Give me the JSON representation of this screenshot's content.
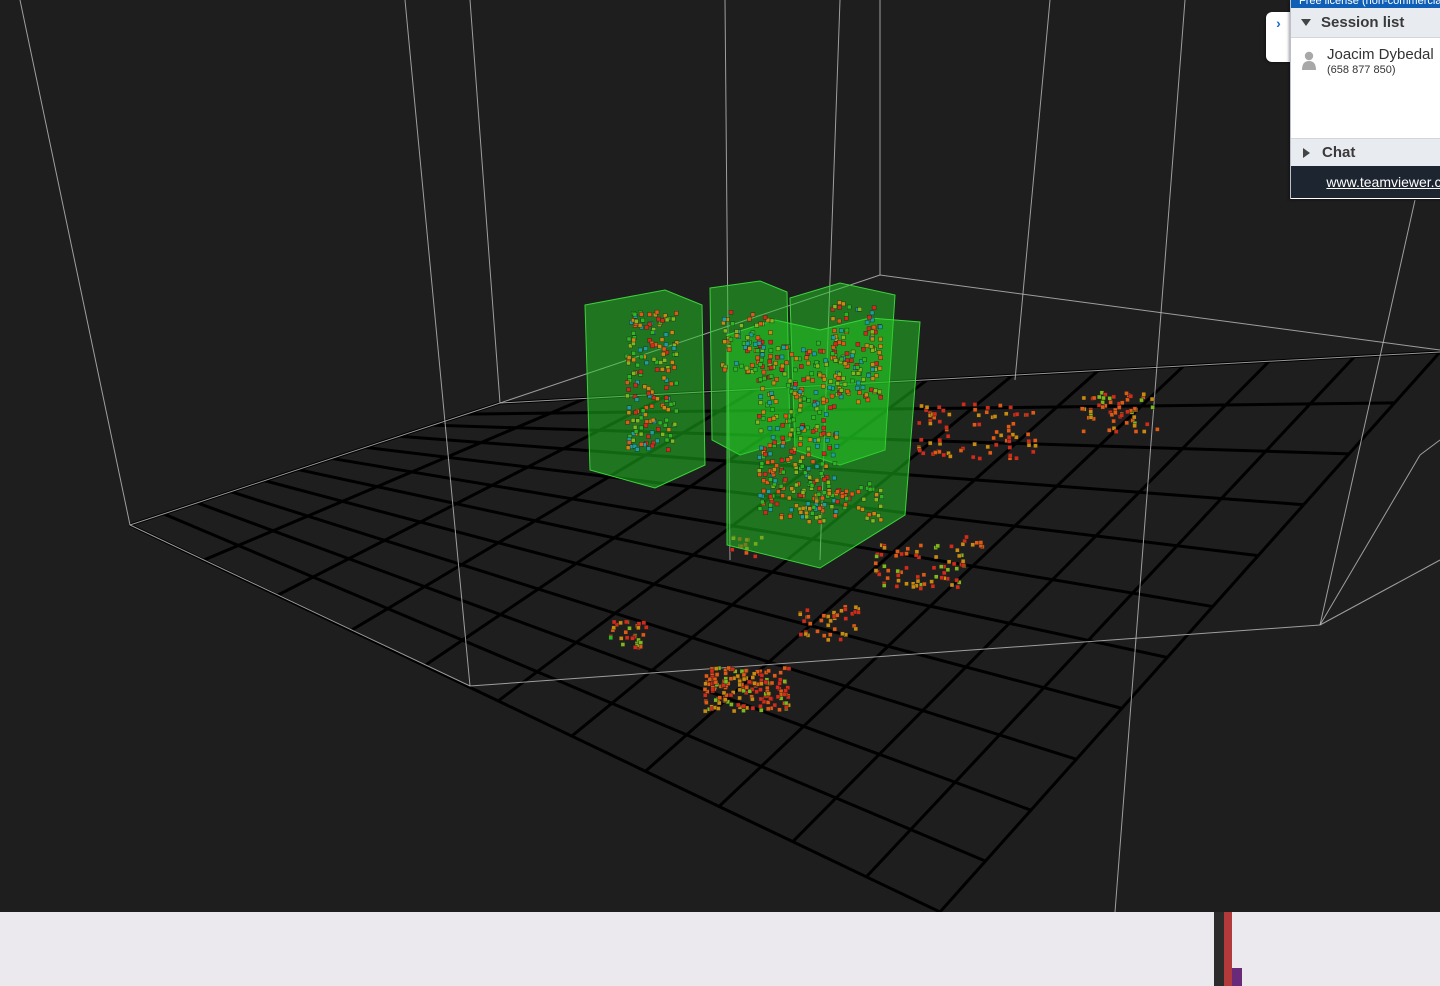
{
  "teamviewer": {
    "top_strip_text": "Free license (non-commercial use only)",
    "session_list_label": "Session list",
    "user_name": "Joacim Dybedal",
    "user_id": "(658 877 850)",
    "chat_label": "Chat",
    "footer_link": "www.teamviewer.com",
    "collapse_glyph": "›"
  },
  "scene": {
    "background": "#1e1e1e",
    "grid_color": "#000000",
    "box_color": "#22cc22",
    "frame_color": "#bfbfbf",
    "point_colors": [
      "#d42a1a",
      "#e05a14",
      "#c98a10",
      "#7fb81a",
      "#2ab820",
      "#1aa0a0"
    ]
  },
  "icons": {
    "user": "user-icon",
    "collapse": "chevron-right-icon",
    "expand": "triangle-down-icon",
    "collapsed": "triangle-right-icon"
  }
}
